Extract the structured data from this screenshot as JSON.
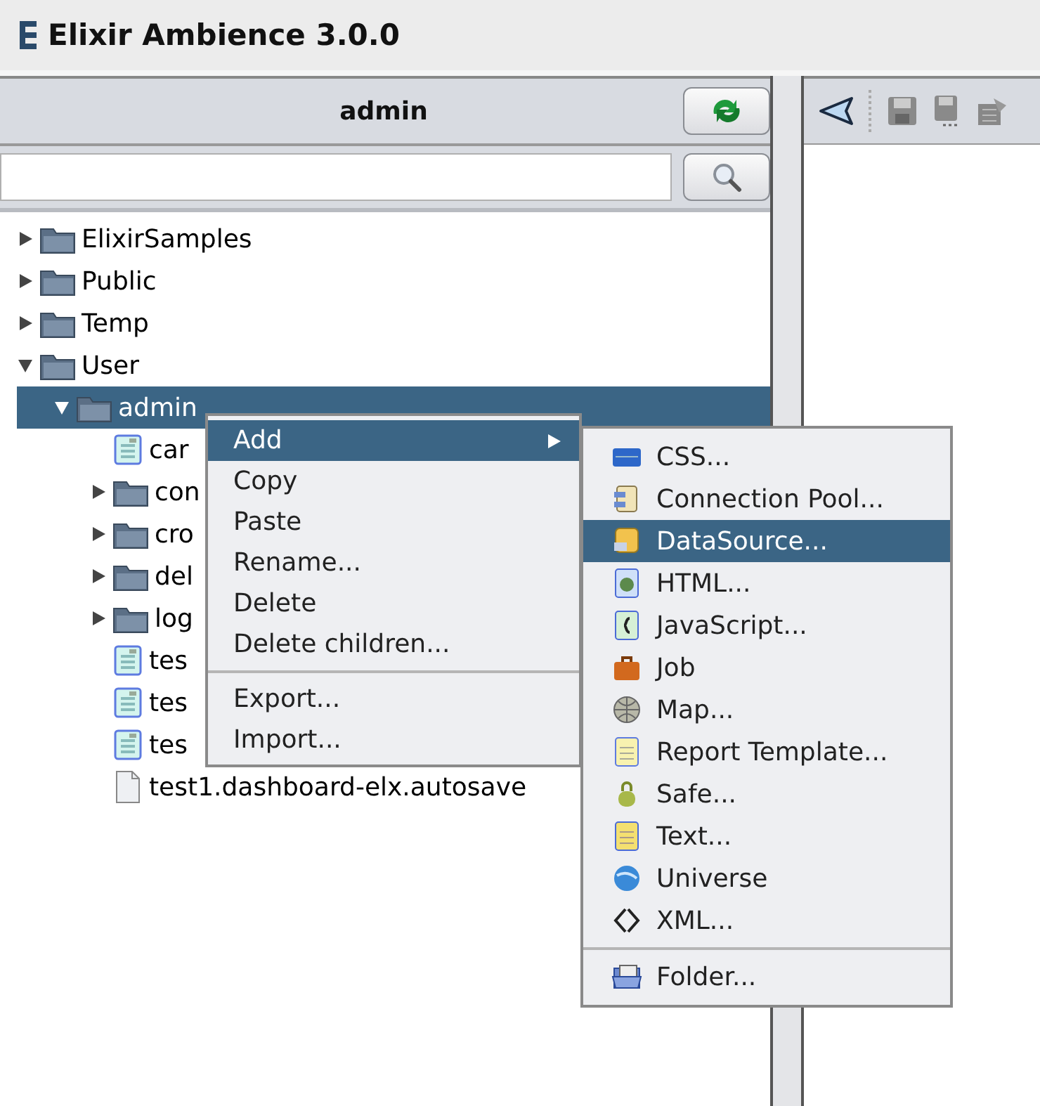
{
  "window": {
    "title": "Elixir Ambience 3.0.0"
  },
  "left_panel": {
    "header": "admin"
  },
  "tree": [
    {
      "label": "ElixirSamples",
      "kind": "folder",
      "expanded": false,
      "selected": false
    },
    {
      "label": "Public",
      "kind": "folder",
      "expanded": false,
      "selected": false
    },
    {
      "label": "Temp",
      "kind": "folder",
      "expanded": false,
      "selected": false
    },
    {
      "label": "User",
      "kind": "folder",
      "expanded": true,
      "selected": false,
      "children": [
        {
          "label": "admin",
          "kind": "folder",
          "expanded": true,
          "selected": true,
          "children": [
            {
              "label": "car",
              "kind": "document",
              "selected": false
            },
            {
              "label": "con",
              "kind": "folder",
              "expanded": false,
              "selected": false
            },
            {
              "label": "cro",
              "kind": "folder",
              "expanded": false,
              "selected": false
            },
            {
              "label": "del",
              "kind": "folder",
              "expanded": false,
              "selected": false
            },
            {
              "label": "log",
              "kind": "folder",
              "expanded": false,
              "selected": false
            },
            {
              "label": "tes",
              "kind": "document",
              "selected": false
            },
            {
              "label": "tes",
              "kind": "document",
              "selected": false
            },
            {
              "label": "tes",
              "kind": "document",
              "selected": false
            },
            {
              "label": "test1.dashboard-elx.autosave",
              "kind": "file",
              "selected": false
            }
          ]
        }
      ]
    }
  ],
  "context_menu": {
    "groups": [
      [
        {
          "label": "Add",
          "selected": true,
          "submenu": true
        },
        {
          "label": "Copy",
          "selected": false,
          "submenu": false
        },
        {
          "label": "Paste",
          "selected": false,
          "submenu": false
        },
        {
          "label": "Rename...",
          "selected": false,
          "submenu": false
        },
        {
          "label": "Delete",
          "selected": false,
          "submenu": false
        },
        {
          "label": "Delete children...",
          "selected": false,
          "submenu": false
        }
      ],
      [
        {
          "label": "Export...",
          "selected": false,
          "submenu": false
        },
        {
          "label": "Import...",
          "selected": false,
          "submenu": false
        }
      ]
    ]
  },
  "submenu": {
    "groups": [
      [
        {
          "label": "CSS...",
          "kind": "css",
          "selected": false
        },
        {
          "label": "Connection Pool...",
          "kind": "connection",
          "selected": false
        },
        {
          "label": "DataSource...",
          "kind": "datasource",
          "selected": true
        },
        {
          "label": "HTML...",
          "kind": "html",
          "selected": false
        },
        {
          "label": "JavaScript...",
          "kind": "javascript",
          "selected": false
        },
        {
          "label": "Job",
          "kind": "job",
          "selected": false
        },
        {
          "label": "Map...",
          "kind": "map",
          "selected": false
        },
        {
          "label": "Report Template...",
          "kind": "report",
          "selected": false
        },
        {
          "label": "Safe...",
          "kind": "safe",
          "selected": false
        },
        {
          "label": "Text...",
          "kind": "text",
          "selected": false
        },
        {
          "label": "Universe",
          "kind": "universe",
          "selected": false
        },
        {
          "label": "XML...",
          "kind": "xml",
          "selected": false
        }
      ],
      [
        {
          "label": "Folder...",
          "kind": "folder",
          "selected": false
        }
      ]
    ]
  }
}
